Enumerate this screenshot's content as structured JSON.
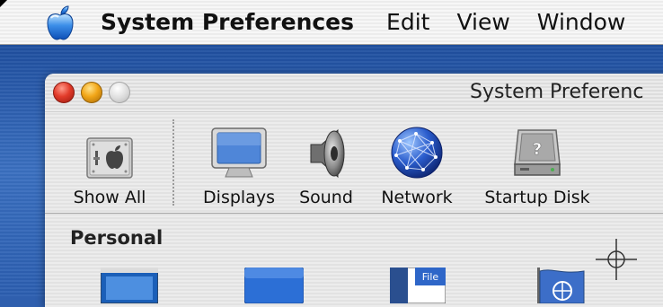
{
  "menubar": {
    "apple_icon": "apple-logo-icon",
    "app_name": "System Preferences",
    "items": [
      "Edit",
      "View",
      "Window"
    ]
  },
  "window": {
    "title": "System Preferenc",
    "buttons": [
      "close",
      "minimize",
      "zoom"
    ]
  },
  "toolbar": {
    "items": [
      {
        "label": "Show All",
        "icon": "show-all-icon"
      },
      {
        "label": "Displays",
        "icon": "display-icon"
      },
      {
        "label": "Sound",
        "icon": "speaker-icon"
      },
      {
        "label": "Network",
        "icon": "globe-icon"
      },
      {
        "label": "Startup Disk",
        "icon": "hard-disk-icon"
      }
    ]
  },
  "sections": {
    "personal": {
      "title": "Personal",
      "panes": [
        {
          "icon": "desktop-icon"
        },
        {
          "icon": "dock-icon"
        },
        {
          "icon": "general-file-icon",
          "text": "File"
        },
        {
          "icon": "international-flag-icon"
        }
      ]
    }
  },
  "colors": {
    "close": "#e23b2a",
    "minimize": "#f2a618",
    "zoom": "#dcdcdc",
    "desktop": "#2f5fae"
  }
}
